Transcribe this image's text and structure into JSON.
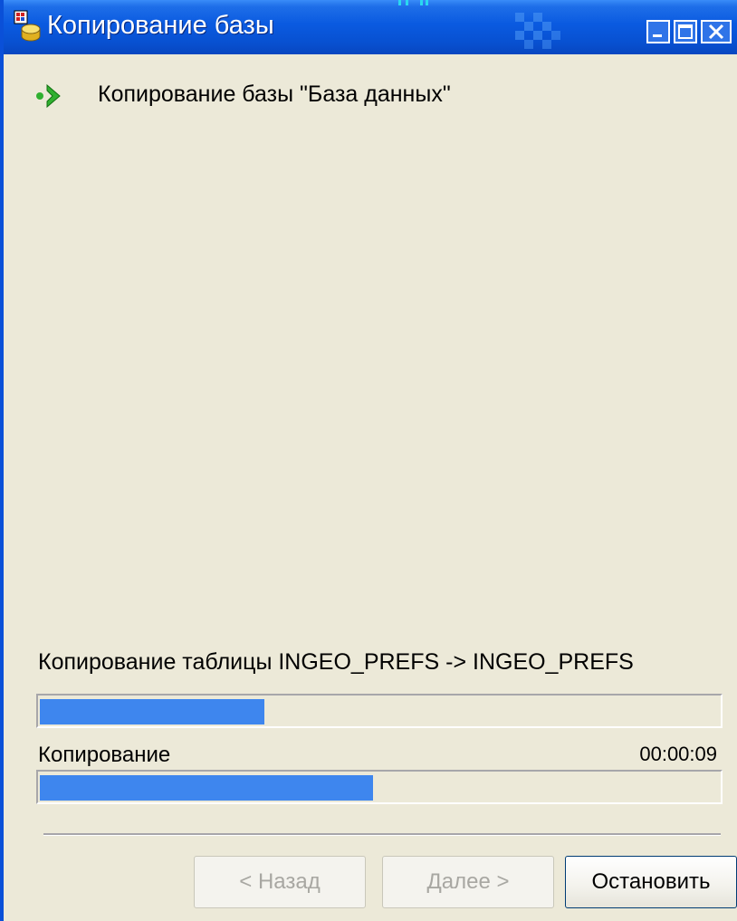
{
  "window": {
    "title": "Копирование базы"
  },
  "step": {
    "text": "Копирование базы \"База данных\""
  },
  "status": {
    "text": "Копирование таблицы INGEO_PREFS -> INGEO_PREFS"
  },
  "progress": {
    "table_progress": 0.33,
    "overall_progress": 0.49,
    "label": "Копирование",
    "elapsed": "00:00:09"
  },
  "buttons": {
    "back_label": "< Назад",
    "next_label": "Далее >",
    "stop_label": "Остановить"
  },
  "colors": {
    "titlebar": "#0a5ae0",
    "progress_fill": "#3e86ee",
    "background": "#ece9d8"
  },
  "icons": {
    "app": "database-copy-icon",
    "step": "green-arrow-icon"
  }
}
